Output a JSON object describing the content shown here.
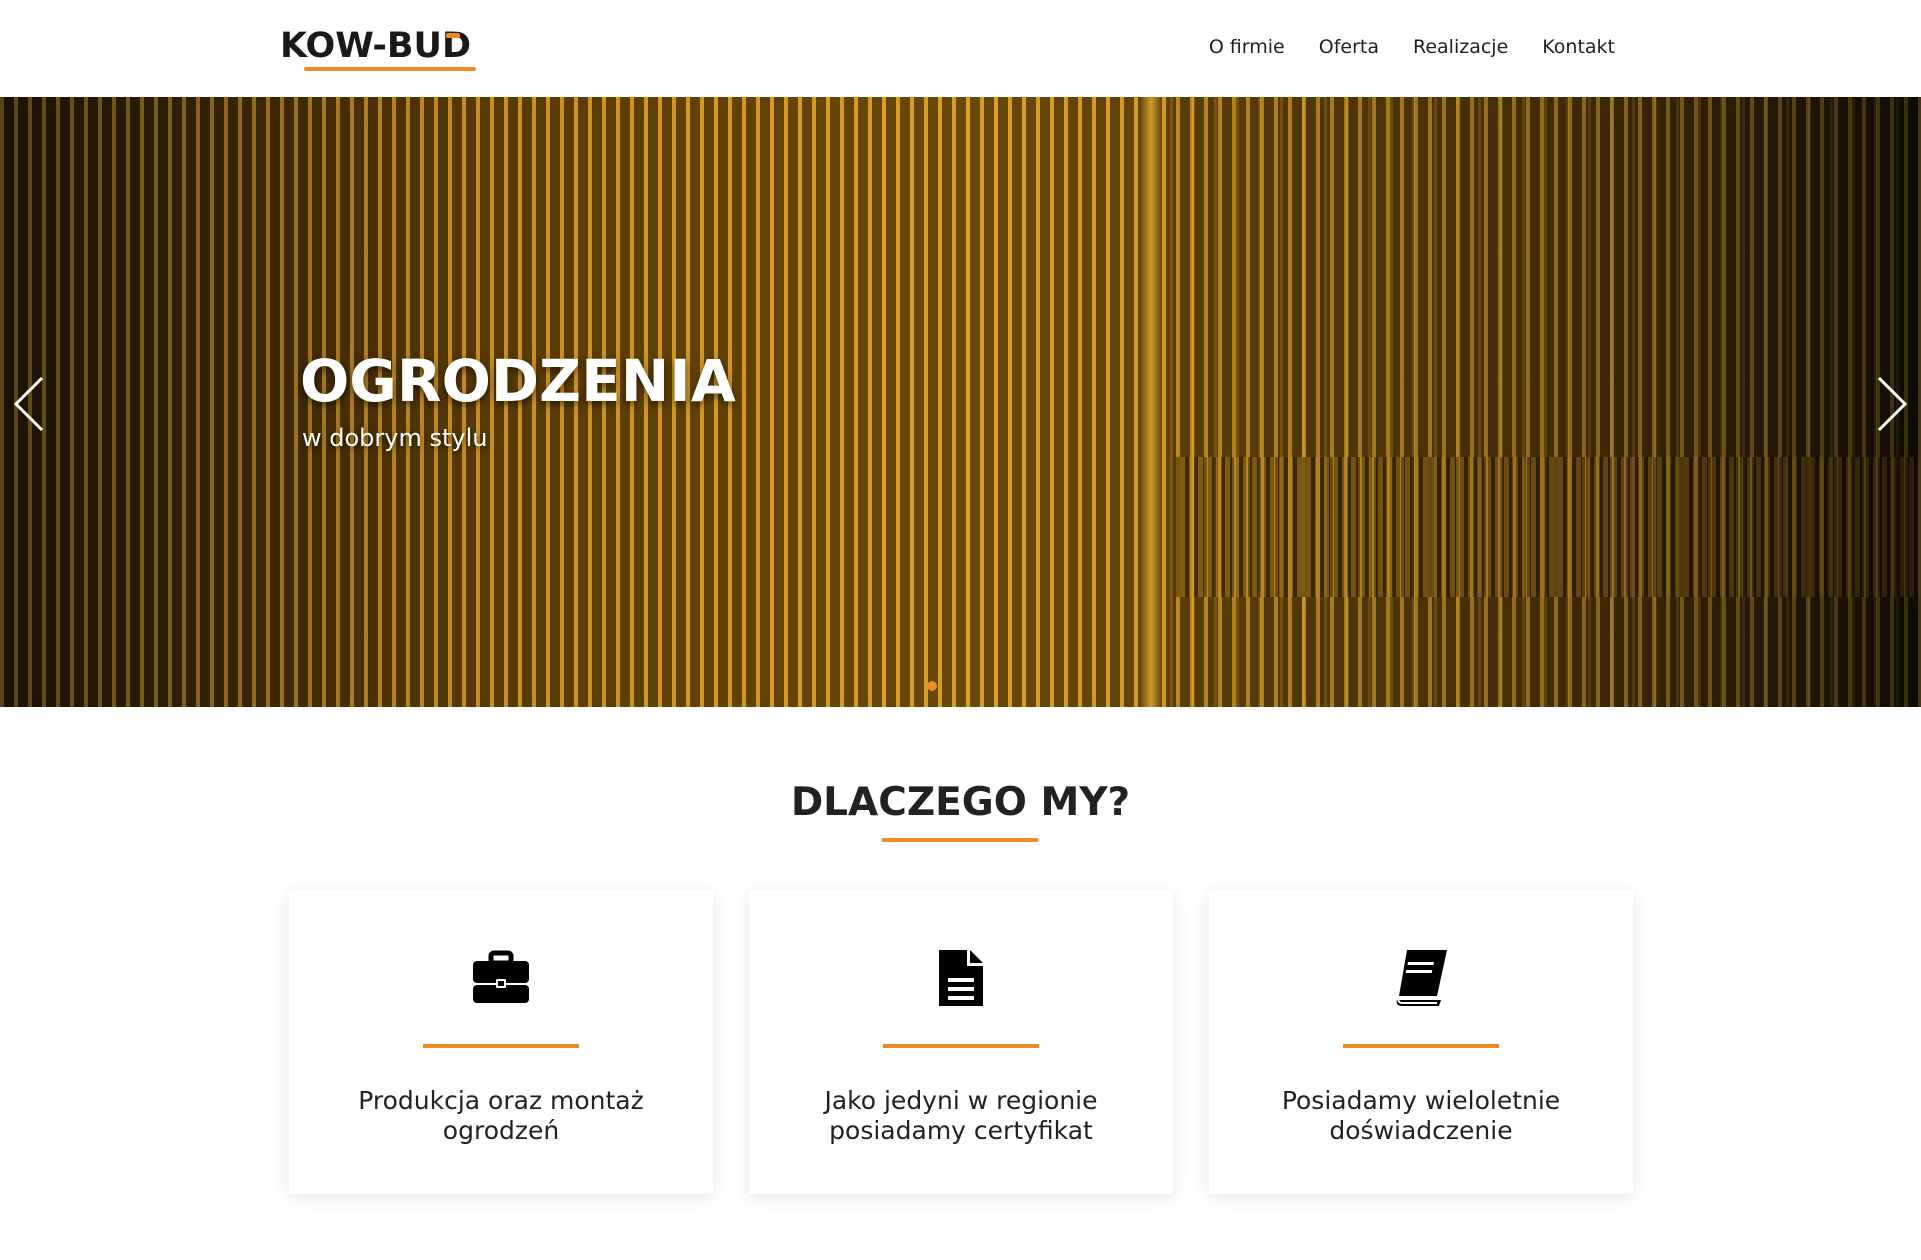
{
  "brand": {
    "logo_text": "KOW-BUD",
    "accent_color": "#f08a24"
  },
  "nav": {
    "items": [
      {
        "label": "O firmie"
      },
      {
        "label": "Oferta"
      },
      {
        "label": "Realizacje"
      },
      {
        "label": "Kontakt"
      }
    ]
  },
  "hero": {
    "title": "OGRODZENIA",
    "subtitle": "w dobrym stylu",
    "prev_icon": "chevron-left-icon",
    "next_icon": "chevron-right-icon",
    "slide_count": 1,
    "active_slide": 1
  },
  "why": {
    "title": "DLACZEGO MY?",
    "cards": [
      {
        "icon": "briefcase-icon",
        "text": "Produkcja oraz montaż ogrodzeń"
      },
      {
        "icon": "document-icon",
        "text": "Jako jedyni w regionie posiadamy certyfikat"
      },
      {
        "icon": "book-icon",
        "text": "Posiadamy wieloletnie doświadczenie"
      }
    ]
  }
}
